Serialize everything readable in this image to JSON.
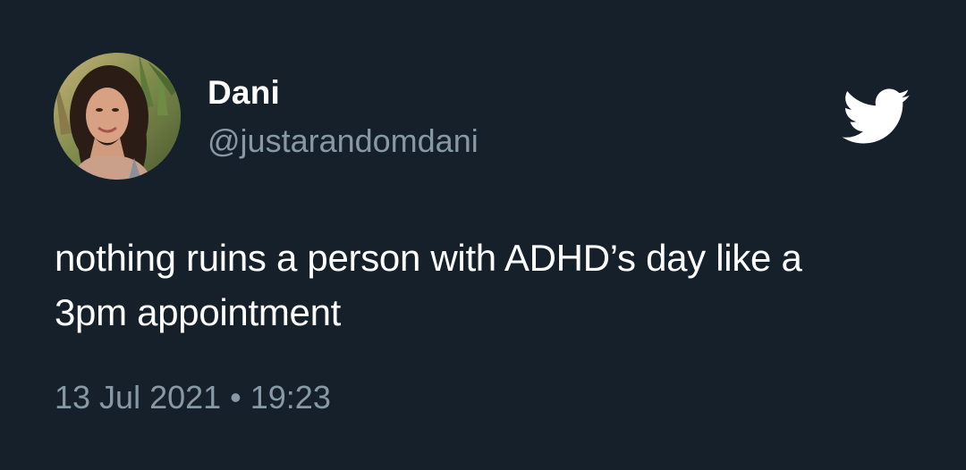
{
  "author": {
    "display_name": "Dani",
    "handle": "@justarandomdani",
    "avatar_icon": "profile-photo"
  },
  "tweet": {
    "text_line_1": "nothing ruins a person with ADHD’s day like a",
    "text_line_2": "3pm appointment",
    "date": "13 Jul 2021",
    "separator": "•",
    "time": "19:23"
  },
  "brand": {
    "logo_icon": "twitter-bird-icon",
    "logo_color": "#ffffff"
  },
  "colors": {
    "background": "#15202b",
    "primary_text": "#ffffff",
    "secondary_text": "#8899a6"
  }
}
